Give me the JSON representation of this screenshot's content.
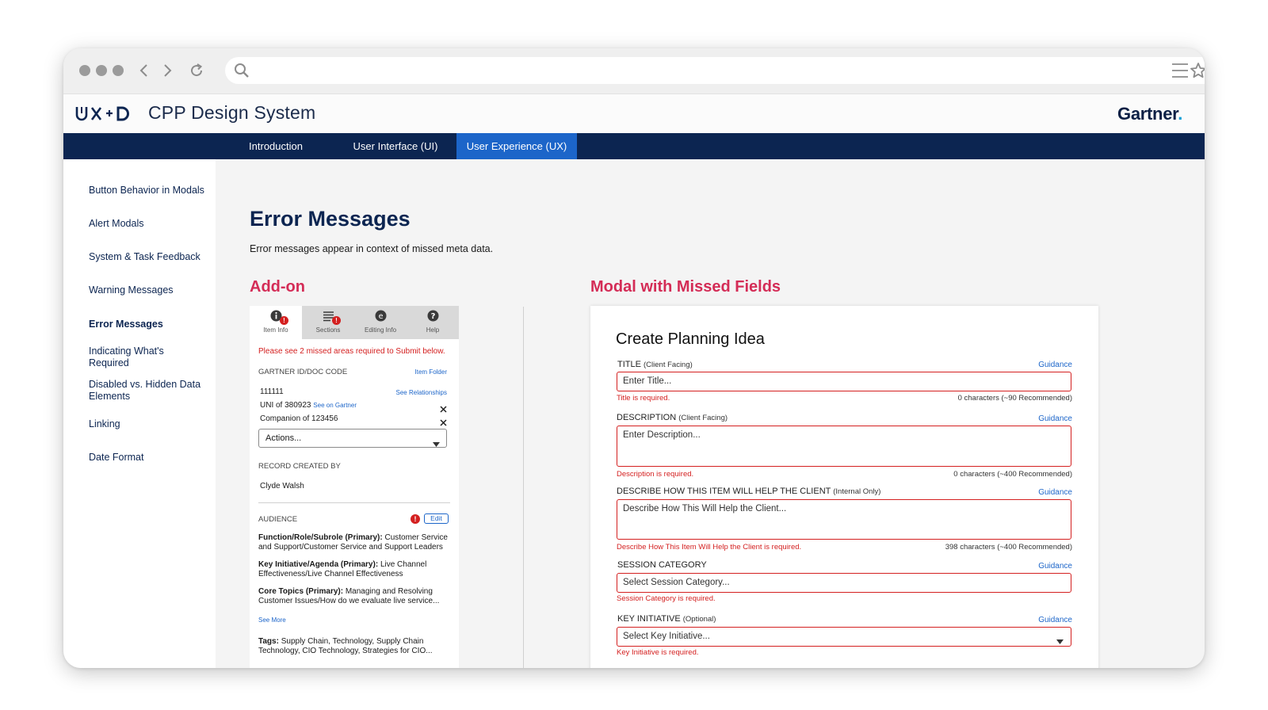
{
  "app": {
    "title": "CPP Design System",
    "logo_text": "UX+D",
    "brand": "Gartner",
    "brand_mark": "."
  },
  "nav": {
    "tabs": [
      {
        "label": "Introduction"
      },
      {
        "label": "User Interface (UI)"
      },
      {
        "label": "User Experience (UX)",
        "active": true
      }
    ]
  },
  "sidebar": {
    "items": [
      {
        "label": "Button Behavior in Modals"
      },
      {
        "label": "Alert Modals"
      },
      {
        "label": "System & Task Feedback"
      },
      {
        "label": "Warning Messages"
      },
      {
        "label": "Error Messages",
        "active": true
      },
      {
        "label": "Indicating What's Required"
      },
      {
        "label": "Disabled vs. Hidden Data Elements"
      },
      {
        "label": "Linking"
      },
      {
        "label": "Date Format"
      }
    ]
  },
  "main": {
    "title": "Error Messages",
    "description": "Error messages appear in context of missed meta data.",
    "addon_heading": "Add-on",
    "modal_heading": "Modal with Missed Fields"
  },
  "addon": {
    "tabs": [
      {
        "label": "Item Info",
        "icon": "info-icon",
        "badge": "!"
      },
      {
        "label": "Sections",
        "icon": "list-icon",
        "badge": "!"
      },
      {
        "label": "Editing Info",
        "icon": "edit-circle-icon"
      },
      {
        "label": "Help",
        "icon": "help-icon"
      }
    ],
    "error_summary": "Please see 2 missed areas required to Submit below.",
    "id_label": "GARTNER ID/DOC CODE",
    "item_folder_link": "Item Folder",
    "id_value": "111111",
    "relationships_link": "See Relationships",
    "uni_text": "UNI of 380923",
    "see_on_gartner_link": "See on Gartner",
    "companion_text": "Companion of 123456",
    "actions_label": "Actions...",
    "record_label": "RECORD CREATED BY",
    "record_value": "Clyde Walsh",
    "audience_label": "AUDIENCE",
    "audience_badge": "!",
    "edit_label": "Edit",
    "function_label": "Function/Role/Subrole (Primary):",
    "function_value": "Customer Service and Support/Customer Service and Support Leaders",
    "initiative_label": "Key Initiative/Agenda (Primary):",
    "initiative_value": "Live Channel Effectiveness/Live Channel Effectiveness",
    "core_label": "Core Topics (Primary):",
    "core_value": "Managing and Resolving Customer Issues/How do we evaluate live service...",
    "see_more_link": "See More",
    "tags_label": "Tags:",
    "tags_value": "Supply Chain, Technology, Supply Chain Technology, CIO Technology, Strategies for CIO..."
  },
  "modal": {
    "title": "Create Planning Idea",
    "guidance_label": "Guidance",
    "fields": [
      {
        "label": "TITLE",
        "note": "(Client Facing)",
        "placeholder": "Enter Title...",
        "error": "Title is required.",
        "count": "0 characters (~90 Recommended)"
      },
      {
        "label": "DESCRIPTION",
        "note": "(Client Facing)",
        "placeholder": "Enter Description...",
        "error": "Description is required.",
        "count": "0 characters (~400 Recommended)"
      },
      {
        "label": "DESCRIBE HOW THIS ITEM WILL HELP THE CLIENT",
        "note": "(Internal Only)",
        "placeholder": "Describe How This Will Help the Client...",
        "error": "Describe How This Item Will Help the Client is required.",
        "count": "398 characters (~400 Recommended)"
      },
      {
        "label": "SESSION CATEGORY",
        "note": "",
        "placeholder": "Select Session Category...",
        "error": "Session Category is required."
      },
      {
        "label": "KEY INITIATIVE",
        "note": "(Optional)",
        "placeholder": "Select Key Initiative...",
        "error": "Key Initiative is required."
      }
    ]
  },
  "colors": {
    "nav_bg": "#0c2551",
    "nav_active": "#1c65c9",
    "accent_heading": "#d42c56",
    "error": "#d42020",
    "link": "#1c65c9"
  }
}
